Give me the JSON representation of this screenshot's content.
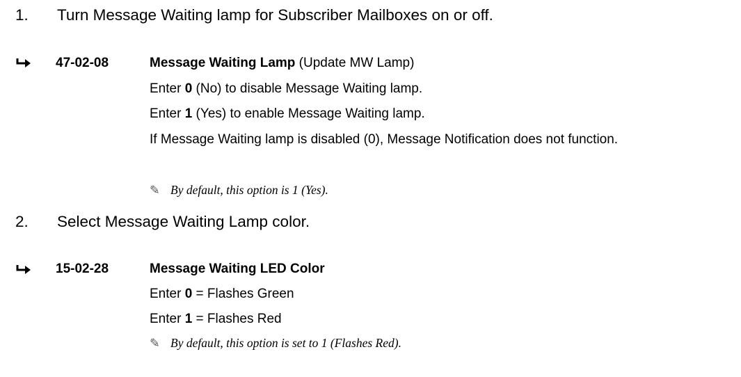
{
  "step1": {
    "number": "1.",
    "text": "Turn Message Waiting lamp for Subscriber Mailboxes on or off."
  },
  "program1": {
    "code": "47-02-08",
    "title": "Message Waiting Lamp",
    "title_suffix": "(Update MW Lamp)",
    "line1": {
      "pre": "Enter ",
      "value": "0",
      "post": " (No) to disable Message Waiting lamp."
    },
    "line2": {
      "pre": "Enter ",
      "value": "1",
      "post": " (Yes) to enable Message Waiting lamp."
    },
    "line3": "If Message Waiting lamp is disabled (0), Message Notification does not function.",
    "note": "By default, this option is 1 (Yes)."
  },
  "step2": {
    "number": "2.",
    "text": "Select Message Waiting Lamp color."
  },
  "program2": {
    "code": "15-02-28",
    "title": "Message Waiting LED Color",
    "line1": {
      "pre": "Enter ",
      "value": "0",
      "post": " = Flashes Green"
    },
    "line2": {
      "pre": "Enter ",
      "value": "1",
      "post": " = Flashes Red"
    },
    "note": "By default, this option is set to 1 (Flashes Red)."
  },
  "icons": {
    "arrow": "right-hook-arrow-icon",
    "note": "pencil-icon"
  }
}
